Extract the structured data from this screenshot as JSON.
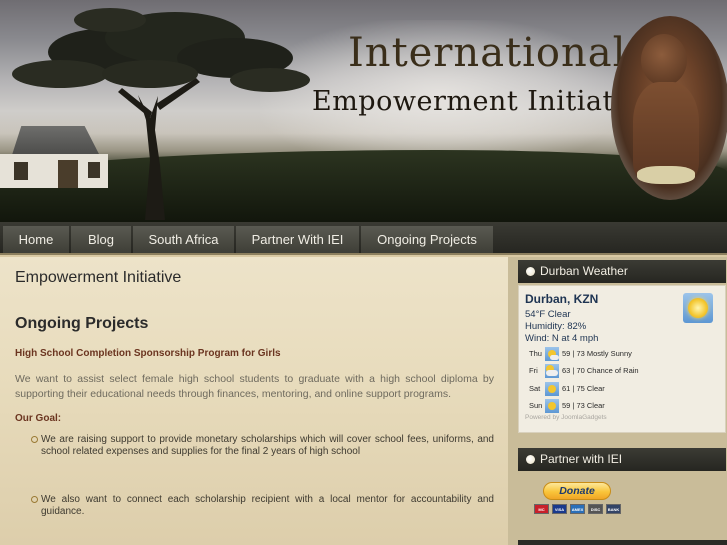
{
  "header": {
    "title": "International",
    "subtitle": "Empowerment Initiative"
  },
  "nav": {
    "items": [
      "Home",
      "Blog",
      "South Africa",
      "Partner With IEI",
      "Ongoing Projects"
    ]
  },
  "main": {
    "page_title": "Empowerment Initiative",
    "section_title": "Ongoing Projects",
    "program_heading": "High School Completion Sponsorship Program for Girls",
    "intro": "We want to assist select female high school students to graduate with a high school diploma by supporting their educational needs through finances, mentoring, and online support programs.",
    "goal_heading": "Our Goal:",
    "goals": [
      "We are raising support to provide monetary scholarships which will cover school fees, uniforms, and school related expenses and supplies for the final 2 years of high school",
      "We also want to connect each scholarship recipient with a local mentor for accountability and guidance."
    ]
  },
  "sidebar": {
    "weather": {
      "title": "Durban Weather",
      "location": "Durban, KZN",
      "current": "54°F  Clear",
      "humidity": "Humidity: 82%",
      "wind": "Wind: N at 4 mph",
      "icon": "sunny-icon",
      "forecast": [
        {
          "day": "Thu",
          "text": "59 | 73 Mostly Sunny",
          "icon": "mostly-sunny-icon"
        },
        {
          "day": "Fri",
          "text": "63 | 70 Chance of Rain",
          "icon": "chance-of-rain-icon"
        },
        {
          "day": "Sat",
          "text": "61 | 75 Clear",
          "icon": "clear-icon"
        },
        {
          "day": "Sun",
          "text": "59 | 73 Clear",
          "icon": "clear-icon"
        }
      ],
      "powered_by": "Powered by JoomlaGadgets"
    },
    "partner": {
      "title": "Partner with IEI",
      "donate_label": "Donate",
      "cards": [
        "MC",
        "VISA",
        "AMEX",
        "DISC",
        "BANK"
      ]
    }
  }
}
